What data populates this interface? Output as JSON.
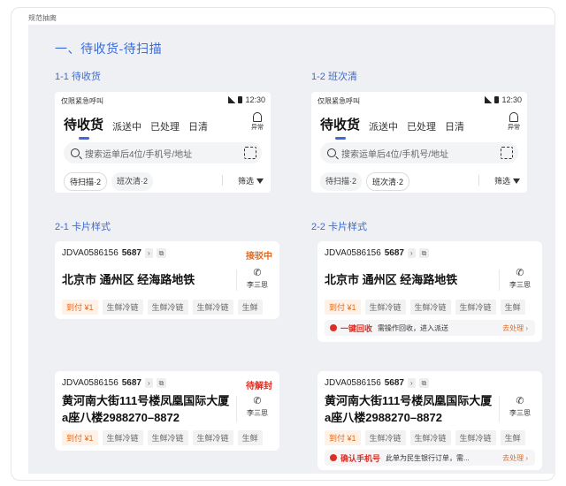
{
  "frame_label": "规范抽离",
  "section_title": "一、待收货-待扫描",
  "colors": {
    "accent": "#3a6bd6",
    "orange": "#e36a1a",
    "red": "#d93025",
    "canvas": "#eef0f4"
  },
  "headers": [
    {
      "subtitle": "1-1 待收货",
      "status_left": "仅限紧急呼叫",
      "time": "12:30",
      "tabs": [
        "待收货",
        "派送中",
        "已处理",
        "日清"
      ],
      "alert_label": "异常",
      "search_placeholder": "搜索运单后4位/手机号/地址",
      "chips": [
        "待扫描·2",
        "班次清·2"
      ],
      "active_chip": 0,
      "filter": "筛选"
    },
    {
      "subtitle": "1-2 班次清",
      "status_left": "仅限紧急呼叫",
      "time": "12:30",
      "tabs": [
        "待收货",
        "派送中",
        "已处理",
        "日清"
      ],
      "alert_label": "异常",
      "search_placeholder": "搜索运单后4位/手机号/地址",
      "chips": [
        "待扫描·2",
        "班次清·2"
      ],
      "active_chip": 1,
      "filter": "筛选"
    }
  ],
  "card_sections": [
    "2-1 卡片样式",
    "2-2 卡片样式"
  ],
  "cards": [
    {
      "waybill": "JDVA0586156",
      "waybill_suffix": "5687",
      "status": "接驳中",
      "status_color": "#e36a1a",
      "address": "北京市 通州区 经海路地铁",
      "contact": "李三思",
      "tags": [
        "到付 ¥1",
        "生鲜冷链",
        "生鲜冷链",
        "生鲜冷链",
        "生鲜"
      ]
    },
    {
      "waybill": "JDVA0586156",
      "waybill_suffix": "5687",
      "status": "",
      "address": "北京市 通州区 经海路地铁",
      "contact": "李三思",
      "tags": [
        "到付 ¥1",
        "生鲜冷链",
        "生鲜冷链",
        "生鲜冷链",
        "生鲜"
      ],
      "notice": {
        "title": "一键回收",
        "text": "需操作回收，进入派送",
        "action": "去处理"
      }
    },
    {
      "waybill": "JDVA0586156",
      "waybill_suffix": "5687",
      "status": "待解封",
      "status_color": "#d93025",
      "address": "黄河南大街111号楼凤凰国际大厦",
      "address2": "a座八楼2988270–8872",
      "contact": "李三思",
      "tags": [
        "到付 ¥1",
        "生鲜冷链",
        "生鲜冷链",
        "生鲜冷链",
        "生鲜"
      ]
    },
    {
      "waybill": "JDVA0586156",
      "waybill_suffix": "5687",
      "status": "",
      "address": "黄河南大街111号楼凤凰国际大厦",
      "address2": "a座八楼2988270–8872",
      "contact": "李三思",
      "tags": [
        "到付 ¥1",
        "生鲜冷链",
        "生鲜冷链",
        "生鲜冷链",
        "生鲜"
      ],
      "notice": {
        "title": "确认手机号",
        "text": "此单为民生银行订单，需...",
        "action": "去处理"
      }
    }
  ]
}
